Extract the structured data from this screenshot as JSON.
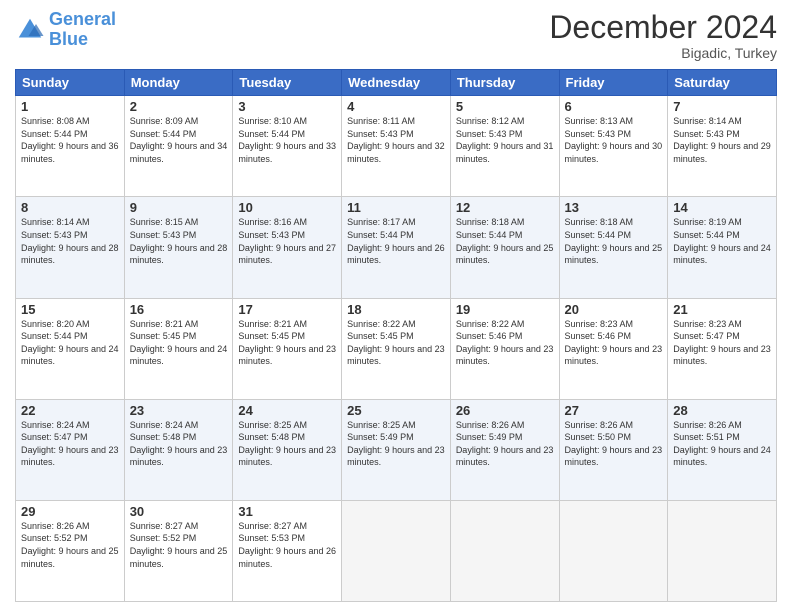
{
  "logo": {
    "line1": "General",
    "line2": "Blue"
  },
  "title": "December 2024",
  "subtitle": "Bigadic, Turkey",
  "days_header": [
    "Sunday",
    "Monday",
    "Tuesday",
    "Wednesday",
    "Thursday",
    "Friday",
    "Saturday"
  ],
  "weeks": [
    [
      {
        "num": "1",
        "sunrise": "8:08 AM",
        "sunset": "5:44 PM",
        "daylight": "9 hours and 36 minutes."
      },
      {
        "num": "2",
        "sunrise": "8:09 AM",
        "sunset": "5:44 PM",
        "daylight": "9 hours and 34 minutes."
      },
      {
        "num": "3",
        "sunrise": "8:10 AM",
        "sunset": "5:44 PM",
        "daylight": "9 hours and 33 minutes."
      },
      {
        "num": "4",
        "sunrise": "8:11 AM",
        "sunset": "5:43 PM",
        "daylight": "9 hours and 32 minutes."
      },
      {
        "num": "5",
        "sunrise": "8:12 AM",
        "sunset": "5:43 PM",
        "daylight": "9 hours and 31 minutes."
      },
      {
        "num": "6",
        "sunrise": "8:13 AM",
        "sunset": "5:43 PM",
        "daylight": "9 hours and 30 minutes."
      },
      {
        "num": "7",
        "sunrise": "8:14 AM",
        "sunset": "5:43 PM",
        "daylight": "9 hours and 29 minutes."
      }
    ],
    [
      {
        "num": "8",
        "sunrise": "8:14 AM",
        "sunset": "5:43 PM",
        "daylight": "9 hours and 28 minutes."
      },
      {
        "num": "9",
        "sunrise": "8:15 AM",
        "sunset": "5:43 PM",
        "daylight": "9 hours and 28 minutes."
      },
      {
        "num": "10",
        "sunrise": "8:16 AM",
        "sunset": "5:43 PM",
        "daylight": "9 hours and 27 minutes."
      },
      {
        "num": "11",
        "sunrise": "8:17 AM",
        "sunset": "5:44 PM",
        "daylight": "9 hours and 26 minutes."
      },
      {
        "num": "12",
        "sunrise": "8:18 AM",
        "sunset": "5:44 PM",
        "daylight": "9 hours and 25 minutes."
      },
      {
        "num": "13",
        "sunrise": "8:18 AM",
        "sunset": "5:44 PM",
        "daylight": "9 hours and 25 minutes."
      },
      {
        "num": "14",
        "sunrise": "8:19 AM",
        "sunset": "5:44 PM",
        "daylight": "9 hours and 24 minutes."
      }
    ],
    [
      {
        "num": "15",
        "sunrise": "8:20 AM",
        "sunset": "5:44 PM",
        "daylight": "9 hours and 24 minutes."
      },
      {
        "num": "16",
        "sunrise": "8:21 AM",
        "sunset": "5:45 PM",
        "daylight": "9 hours and 24 minutes."
      },
      {
        "num": "17",
        "sunrise": "8:21 AM",
        "sunset": "5:45 PM",
        "daylight": "9 hours and 23 minutes."
      },
      {
        "num": "18",
        "sunrise": "8:22 AM",
        "sunset": "5:45 PM",
        "daylight": "9 hours and 23 minutes."
      },
      {
        "num": "19",
        "sunrise": "8:22 AM",
        "sunset": "5:46 PM",
        "daylight": "9 hours and 23 minutes."
      },
      {
        "num": "20",
        "sunrise": "8:23 AM",
        "sunset": "5:46 PM",
        "daylight": "9 hours and 23 minutes."
      },
      {
        "num": "21",
        "sunrise": "8:23 AM",
        "sunset": "5:47 PM",
        "daylight": "9 hours and 23 minutes."
      }
    ],
    [
      {
        "num": "22",
        "sunrise": "8:24 AM",
        "sunset": "5:47 PM",
        "daylight": "9 hours and 23 minutes."
      },
      {
        "num": "23",
        "sunrise": "8:24 AM",
        "sunset": "5:48 PM",
        "daylight": "9 hours and 23 minutes."
      },
      {
        "num": "24",
        "sunrise": "8:25 AM",
        "sunset": "5:48 PM",
        "daylight": "9 hours and 23 minutes."
      },
      {
        "num": "25",
        "sunrise": "8:25 AM",
        "sunset": "5:49 PM",
        "daylight": "9 hours and 23 minutes."
      },
      {
        "num": "26",
        "sunrise": "8:26 AM",
        "sunset": "5:49 PM",
        "daylight": "9 hours and 23 minutes."
      },
      {
        "num": "27",
        "sunrise": "8:26 AM",
        "sunset": "5:50 PM",
        "daylight": "9 hours and 23 minutes."
      },
      {
        "num": "28",
        "sunrise": "8:26 AM",
        "sunset": "5:51 PM",
        "daylight": "9 hours and 24 minutes."
      }
    ],
    [
      {
        "num": "29",
        "sunrise": "8:26 AM",
        "sunset": "5:52 PM",
        "daylight": "9 hours and 25 minutes."
      },
      {
        "num": "30",
        "sunrise": "8:27 AM",
        "sunset": "5:52 PM",
        "daylight": "9 hours and 25 minutes."
      },
      {
        "num": "31",
        "sunrise": "8:27 AM",
        "sunset": "5:53 PM",
        "daylight": "9 hours and 26 minutes."
      },
      null,
      null,
      null,
      null
    ]
  ]
}
